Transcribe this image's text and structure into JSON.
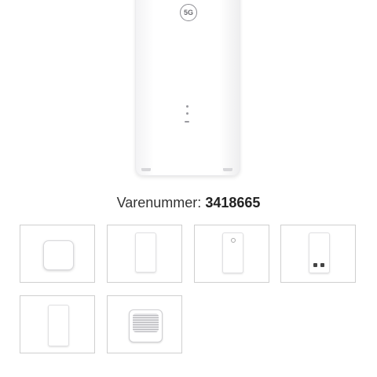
{
  "product": {
    "badge": "5G",
    "sku_label": "Varenummer:",
    "sku_value": "3418665"
  },
  "thumbnails": [
    {
      "name": "square-router-top-view"
    },
    {
      "name": "router-front-view"
    },
    {
      "name": "router-front-view-2"
    },
    {
      "name": "router-back-ports-view"
    },
    {
      "name": "router-side-view"
    },
    {
      "name": "router-vent-detail"
    }
  ]
}
